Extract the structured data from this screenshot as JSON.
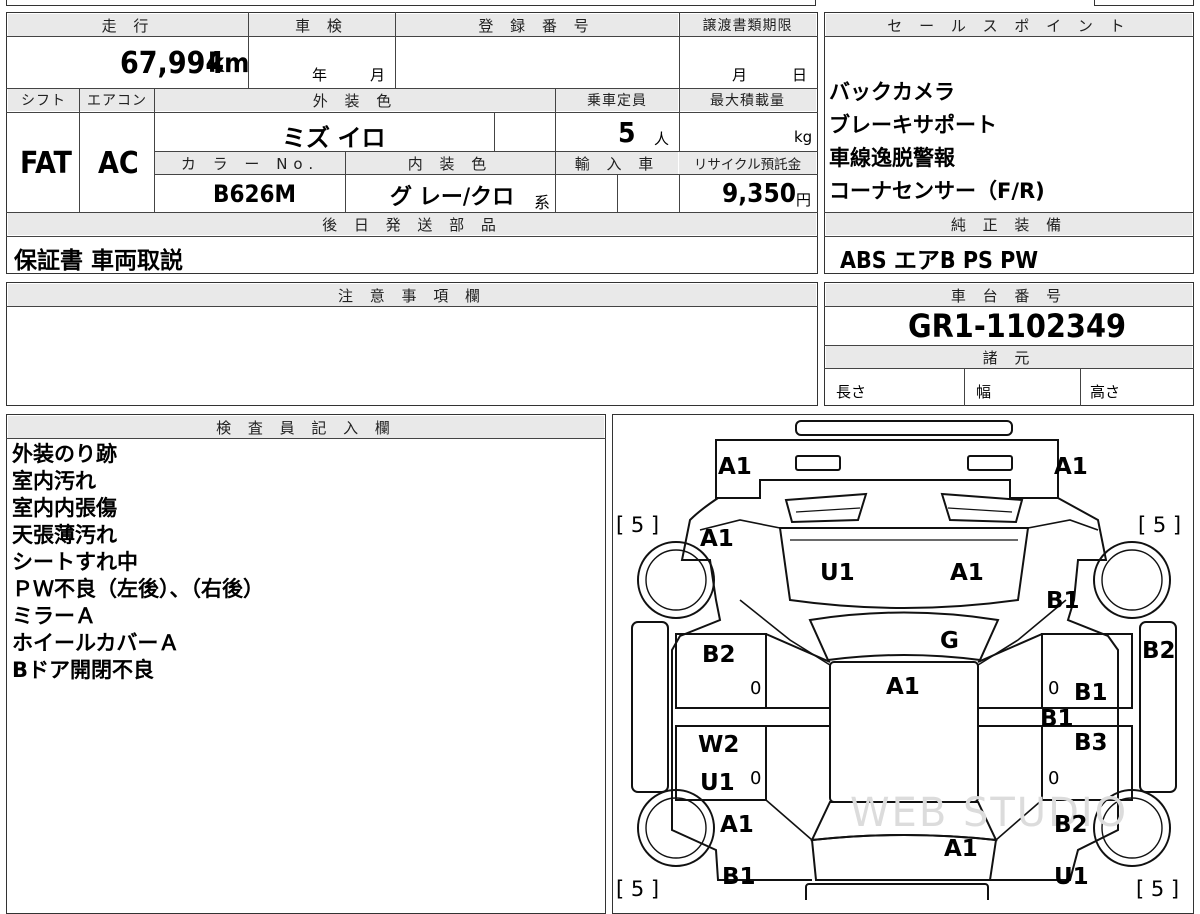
{
  "header": {
    "mileage_label": "走 行",
    "inspection_label": "車 検",
    "registration_label": "登 録 番 号",
    "transfer_deadline_label": "譲渡書類期限",
    "sales_point_label": "セ ー ル ス ポ イ ン ト"
  },
  "vehicle": {
    "mileage": "67,994",
    "mileage_unit": "km",
    "inspection_year": "年",
    "inspection_month": "月",
    "transfer_month": "月",
    "transfer_day": "日",
    "shift_label": "シフト",
    "aircon_label": "エアコン",
    "exterior_color_label": "外 装 色",
    "capacity_label": "乗車定員",
    "max_load_label": "最大積載量",
    "shift": "FAT",
    "aircon": "AC",
    "exterior_color": "ミズ イロ",
    "capacity": "5",
    "capacity_unit": "人",
    "max_load_unit": "kg",
    "color_no_label": "カ ラ ー No.",
    "interior_color_label": "内 装 色",
    "import_label": "輸 入 車",
    "recycle_label": "リサイクル預託金",
    "color_no": "B626M",
    "interior_color": "グ レー/クロ",
    "interior_suffix": "系",
    "recycle_fee": "9,350",
    "recycle_unit": "円"
  },
  "sales_points": [
    "バックカメラ",
    "ブレーキサポート",
    "車線逸脱警報",
    "コーナセンサー（F/R)"
  ],
  "later_parts": {
    "label": "後 日 発 送 部 品",
    "value": "保証書 車両取説"
  },
  "equipment": {
    "label": "純 正 装 備",
    "value": "ABS エアB PS PW"
  },
  "caution": {
    "label": "注 意 事 項 欄"
  },
  "chassis": {
    "label": "車 台 番 号",
    "number": "GR1-1102349"
  },
  "specs": {
    "label": "諸 元",
    "length": "長さ",
    "width": "幅",
    "height": "高さ"
  },
  "inspector": {
    "label": "検 査 員 記 入 欄",
    "notes": [
      "外装のり跡",
      "室内汚れ",
      "室内内張傷",
      "天張薄汚れ",
      "シートすれ中",
      "ＰＷ不良（左後）、（右後）",
      "ミラーＡ",
      "ホイールカバーＡ",
      "Bドア開閉不良"
    ]
  },
  "diagram": {
    "watermark": "WEB STUDIO",
    "tire_left_front": "[ 5 ]",
    "tire_right_front": "[ 5 ]",
    "tire_left_rear": "[ 5 ]",
    "tire_right_rear": "[ 5 ]",
    "front_bumper_left": "A1",
    "front_bumper_right": "A1",
    "left_front_fender": "A1",
    "hood_left": "U1",
    "hood_right": "A1",
    "right_front_fender": "B1",
    "windshield": "G",
    "left_front_door": "B2",
    "left_front_door_0": "0",
    "roof": "A1",
    "right_front_door_0": "0",
    "right_front_door": "B1",
    "right_pillar": "B2",
    "right_rocker": "B1",
    "left_rear_door_a": "W2",
    "left_rear_door_b": "U1",
    "left_rear_door_0": "0",
    "right_rear_door": "B3",
    "right_rear_door_0": "0",
    "left_rear_fender": "A1",
    "right_rear_fender": "B2",
    "rear_gate": "A1",
    "left_rear_bumper": "B1",
    "right_rear_bumper": "U1"
  }
}
